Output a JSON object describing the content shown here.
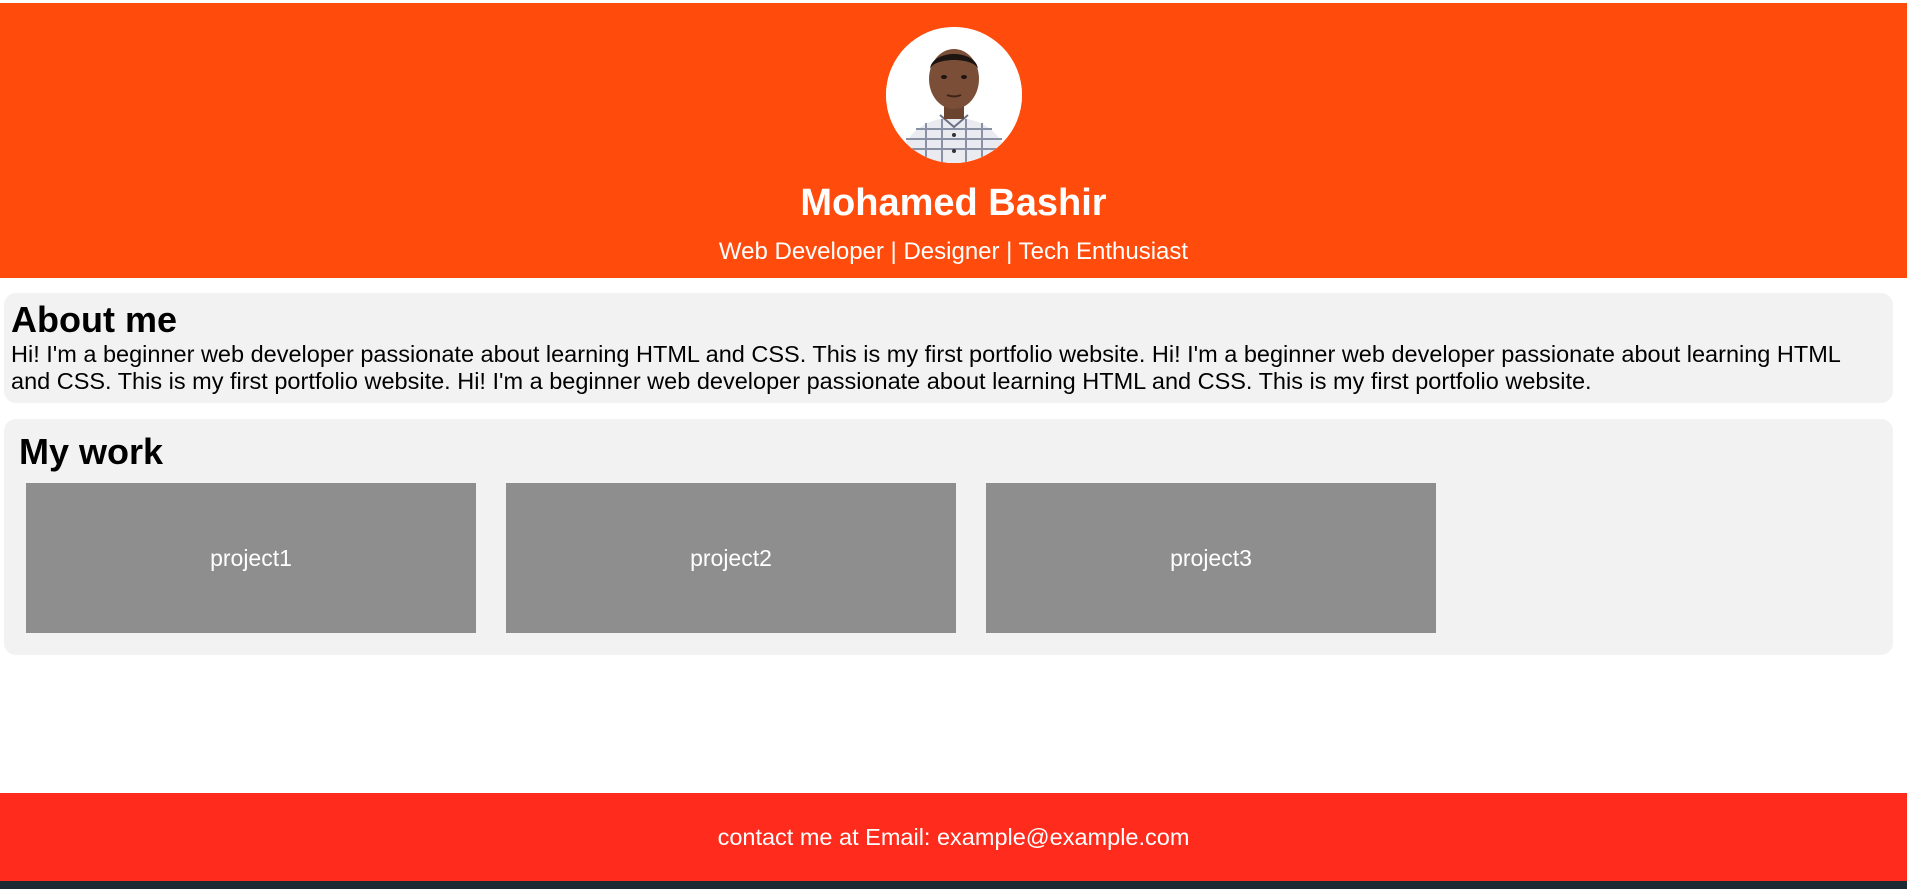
{
  "header": {
    "name": "Mohamed Bashir",
    "tagline": "Web Developer | Designer | Tech Enthusiast",
    "avatar_alt": "profile photo",
    "background_color": "#ff4c0c"
  },
  "about": {
    "heading": "About me",
    "text": "Hi! I'm a beginner web developer passionate about learning HTML and CSS. This is my first portfolio website. Hi! I'm a beginner web developer passionate about learning HTML and CSS. This is my first portfolio website. Hi! I'm a beginner web developer passionate about learning HTML and CSS. This is my first portfolio website."
  },
  "work": {
    "heading": "My work",
    "projects": [
      {
        "label": "project1"
      },
      {
        "label": "project2"
      },
      {
        "label": "project3"
      }
    ]
  },
  "footer": {
    "text": "contact me at Email: example@example.com",
    "background_color": "#ff2b1c"
  }
}
